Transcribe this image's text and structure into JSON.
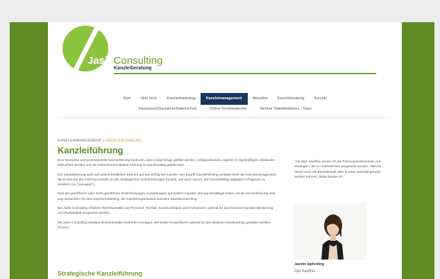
{
  "brand": {
    "name_part1": "Jasis",
    "name_part2": "Consulting",
    "tagline": "Kanzleiberatung"
  },
  "nav": {
    "row1": [
      "Start",
      "über mich",
      "Kanzleimarketing",
      "Kanzleimanagement",
      "Aktuelles",
      "Kanzleiberatung",
      "Kontakt"
    ],
    "active": "Kanzleimanagement",
    "row2": [
      "Impressum/Disclaimer/Datenschutz",
      "Online-Terminkalender",
      "Sichere Videokonferenz - Tixeo"
    ]
  },
  "breadcrumb": {
    "parent": "KANZLEIMANAGEMENT",
    "separator": "»",
    "current": "KANZLEIFÜHRUNG"
  },
  "page_title": "Kanzleiführung",
  "paragraphs": [
    "Eine bewusste und professionelle Kanzleiführung bedeutet, dass einige Dinge geklärt werden, erfolgsrelevante Aspekte in regelmäßigen Abständen beleuchtet werden und die meist kommunikative Führung im Kanzleialltag gelebt wird.",
    "Die Kanzleiführung wirkt auf unterschiedlichen Ebenen auf den Erfolg der Kanzlei. Der Begriff Kanzleiführung umfasst mehr als Kanzleimanagement, da es sich bei der Führung sowohl um die strategischen Entscheidungen handelt, wie auch darum, den Kanzleialltag tagtäglich erfolgreich zu meistern (zu \"managen\").",
    "Weil die getroffenen oder nicht getroffenen Entscheidungen Auswirkungen auf andere Aspekte des Kanzleialltags haben, ist die Kanzleiführung sehr eng verbunden mit dem Kanzleimarketing, der Kanzleiorganisation und dem Kanzleicontrolling.",
    "Bei Jasis Consulting erfahren Rechtsanwälte wie Personal, Technik, Kommunikation und Fachwissen optimal für eine bessere Kundenorientierung und Profitabilität eingesetzt werden.",
    "Mit Jasis Consulting erhalten Rechtsanwälte konkrete Lösungen, wie beide Perspektiven optimal für den weiteren Kanzleierfolg gestaltet werden können."
  ],
  "subheading": "Strategische Kanzleiführung",
  "sidebar": {
    "quote": "\"Als Dipl. Kauffrau kenne ich die Führungsinstrumente und Strategien, die in Unternehmen eingesetzt werden. Welche davon auch als Einzelanwalt oder in einer Sozietät genutzt werden können, dabei berate ich.\"",
    "name": "Jasmin Iapfording",
    "role": "Dipl. Kauffrau"
  },
  "colors": {
    "frame": "#5f8a25",
    "accent": "#6ea12d",
    "nav_active": "#17365a",
    "breadcrumb_current": "#e39a3a"
  }
}
